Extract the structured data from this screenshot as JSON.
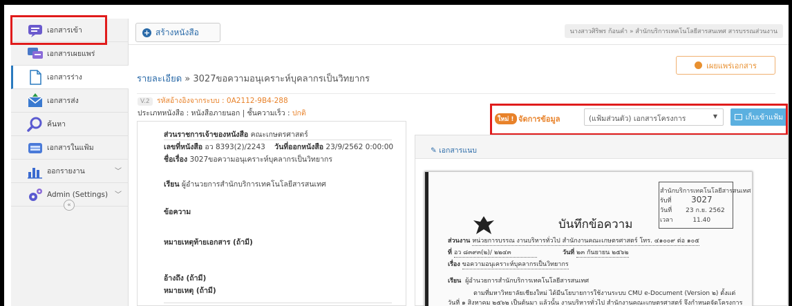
{
  "sidebar": {
    "items": [
      {
        "label": "เอกสารเข้า",
        "icon": "inbox-icon"
      },
      {
        "label": "เอกสารเผยแพร่",
        "icon": "publish-icon"
      },
      {
        "label": "เอกสารร่าง",
        "icon": "draft-icon"
      },
      {
        "label": "เอกสารส่ง",
        "icon": "send-icon"
      },
      {
        "label": "ค้นหา",
        "icon": "search-icon"
      },
      {
        "label": "เอกสารในแฟ้ม",
        "icon": "folder-icon"
      },
      {
        "label": "ออกรายงาน",
        "icon": "report-icon"
      },
      {
        "label": "Admin (Settings)",
        "icon": "gear-icon"
      }
    ],
    "collapse_glyph": "«"
  },
  "topbar": {
    "create_label": "สร้างหนังสือ",
    "breadcrumb": "นางสาวศิริพร ก้อนคำ » สำนักบริการเทคโนโลยีสารสนเทศ สารบรรณส่วนงาน"
  },
  "main": {
    "title_link": "รายละเอียด",
    "title_rest": " » 3027ขอความอนุเคราะห์บุคลากรเป็นวิทยากร",
    "publish_label": "เผยแพร่เอกสาร",
    "version": "V.2",
    "system_code": "รหัสอ้างอิงจากระบบ : 0A2112-9B4-288",
    "type_text": "ประเภทหนังสือ : หนังสือภายนอก | ชั้นความเร็ว : ",
    "urgency": "ปกติ"
  },
  "doc": {
    "owner_label": "ส่วนราชการเจ้าของหนังสือ",
    "owner_value": " คณะเกษตรศาสตร์",
    "number_label": "เลขที่หนังสือ",
    "number_value": " อว 8393(2)/2243",
    "date_label": "วันที่ออกหนังสือ",
    "date_value": " 23/9/2562 0:00:00",
    "subject_label": "ชื่อเรื่อง",
    "subject_value": " 3027ขอความอนุเคราะห์บุคลากรเป็นวิทยากร",
    "to_label": "เรียน",
    "to_value": " ผู้อำนวยการสำนักบริการเทคโนโลยีสารสนเทศ",
    "content_label": "ข้อความ",
    "footnote_label": "หมายเหตุท้ายเอกสาร (ถ้ามี)",
    "ref_label": "อ้างถึง (ถ้ามี)",
    "note_label": "หมายเหตุ (ถ้ามี)"
  },
  "manage": {
    "new_badge": "ใหม่ !",
    "label": "จัดการข้อมูล",
    "folder_value": "(แฟ้มส่วนตัว) เอกสารโครงการ",
    "store_label": "เก็บเข้าแฟ้ม"
  },
  "attach": {
    "label": "เอกสารแนบ",
    "paper": {
      "stamp_org": "สำนักบริการเทคโนโลยีสารสนเทศ",
      "stamp_no": "3027",
      "stamp_date": "23 ก.ย. 2562",
      "stamp_time": "11.40",
      "stamp_l1": "รับที่",
      "stamp_l2": "วันที่",
      "stamp_l3": "เวลา",
      "heading": "บันทึกข้อความ",
      "dept_label": "ส่วนงาน",
      "dept_value": "หน่วยการบรรณ งานบริหารทั่วไป สำนักงานคณะเกษตรศาสตร์ โทร. ๔๑๐๐๙ ต่อ ๑๐๕",
      "no_label": "ที่",
      "no_value": "อว ๘๓๙๓(๒)/ ๒๒๔๓",
      "date_label": "วันที่",
      "date_value": "๒๓ กันยายน ๒๕๖๒",
      "subject_label": "เรื่อง",
      "subject_value": "ขอความอนุเคราะห์บุคลากรเป็นวิทยากร",
      "to_label": "เรียน",
      "to_value": "ผู้อำนวยการสำนักบริการเทคโนโลยีสารสนเทศ",
      "body1": "ตามที่มหาวิทยาลัยเชียงใหม่ ได้มีนโยบายการใช้งานระบบ CMU e-Document (Version ๒) ตั้งแต่",
      "body2": "วันที่ ๑ สิงหาคม ๒๕๖๒ เป็นต้นมา แล้วนั้น งานบริหารทั่วไป สำนักงานคณะเกษตรศาสตร์ จึงกำหนดจัดโครงการ"
    }
  },
  "colors": {
    "accent_blue": "#2a6aa8",
    "accent_orange": "#e8822a",
    "highlight_red": "#e01b1b",
    "button_blue": "#5bb0e0"
  }
}
